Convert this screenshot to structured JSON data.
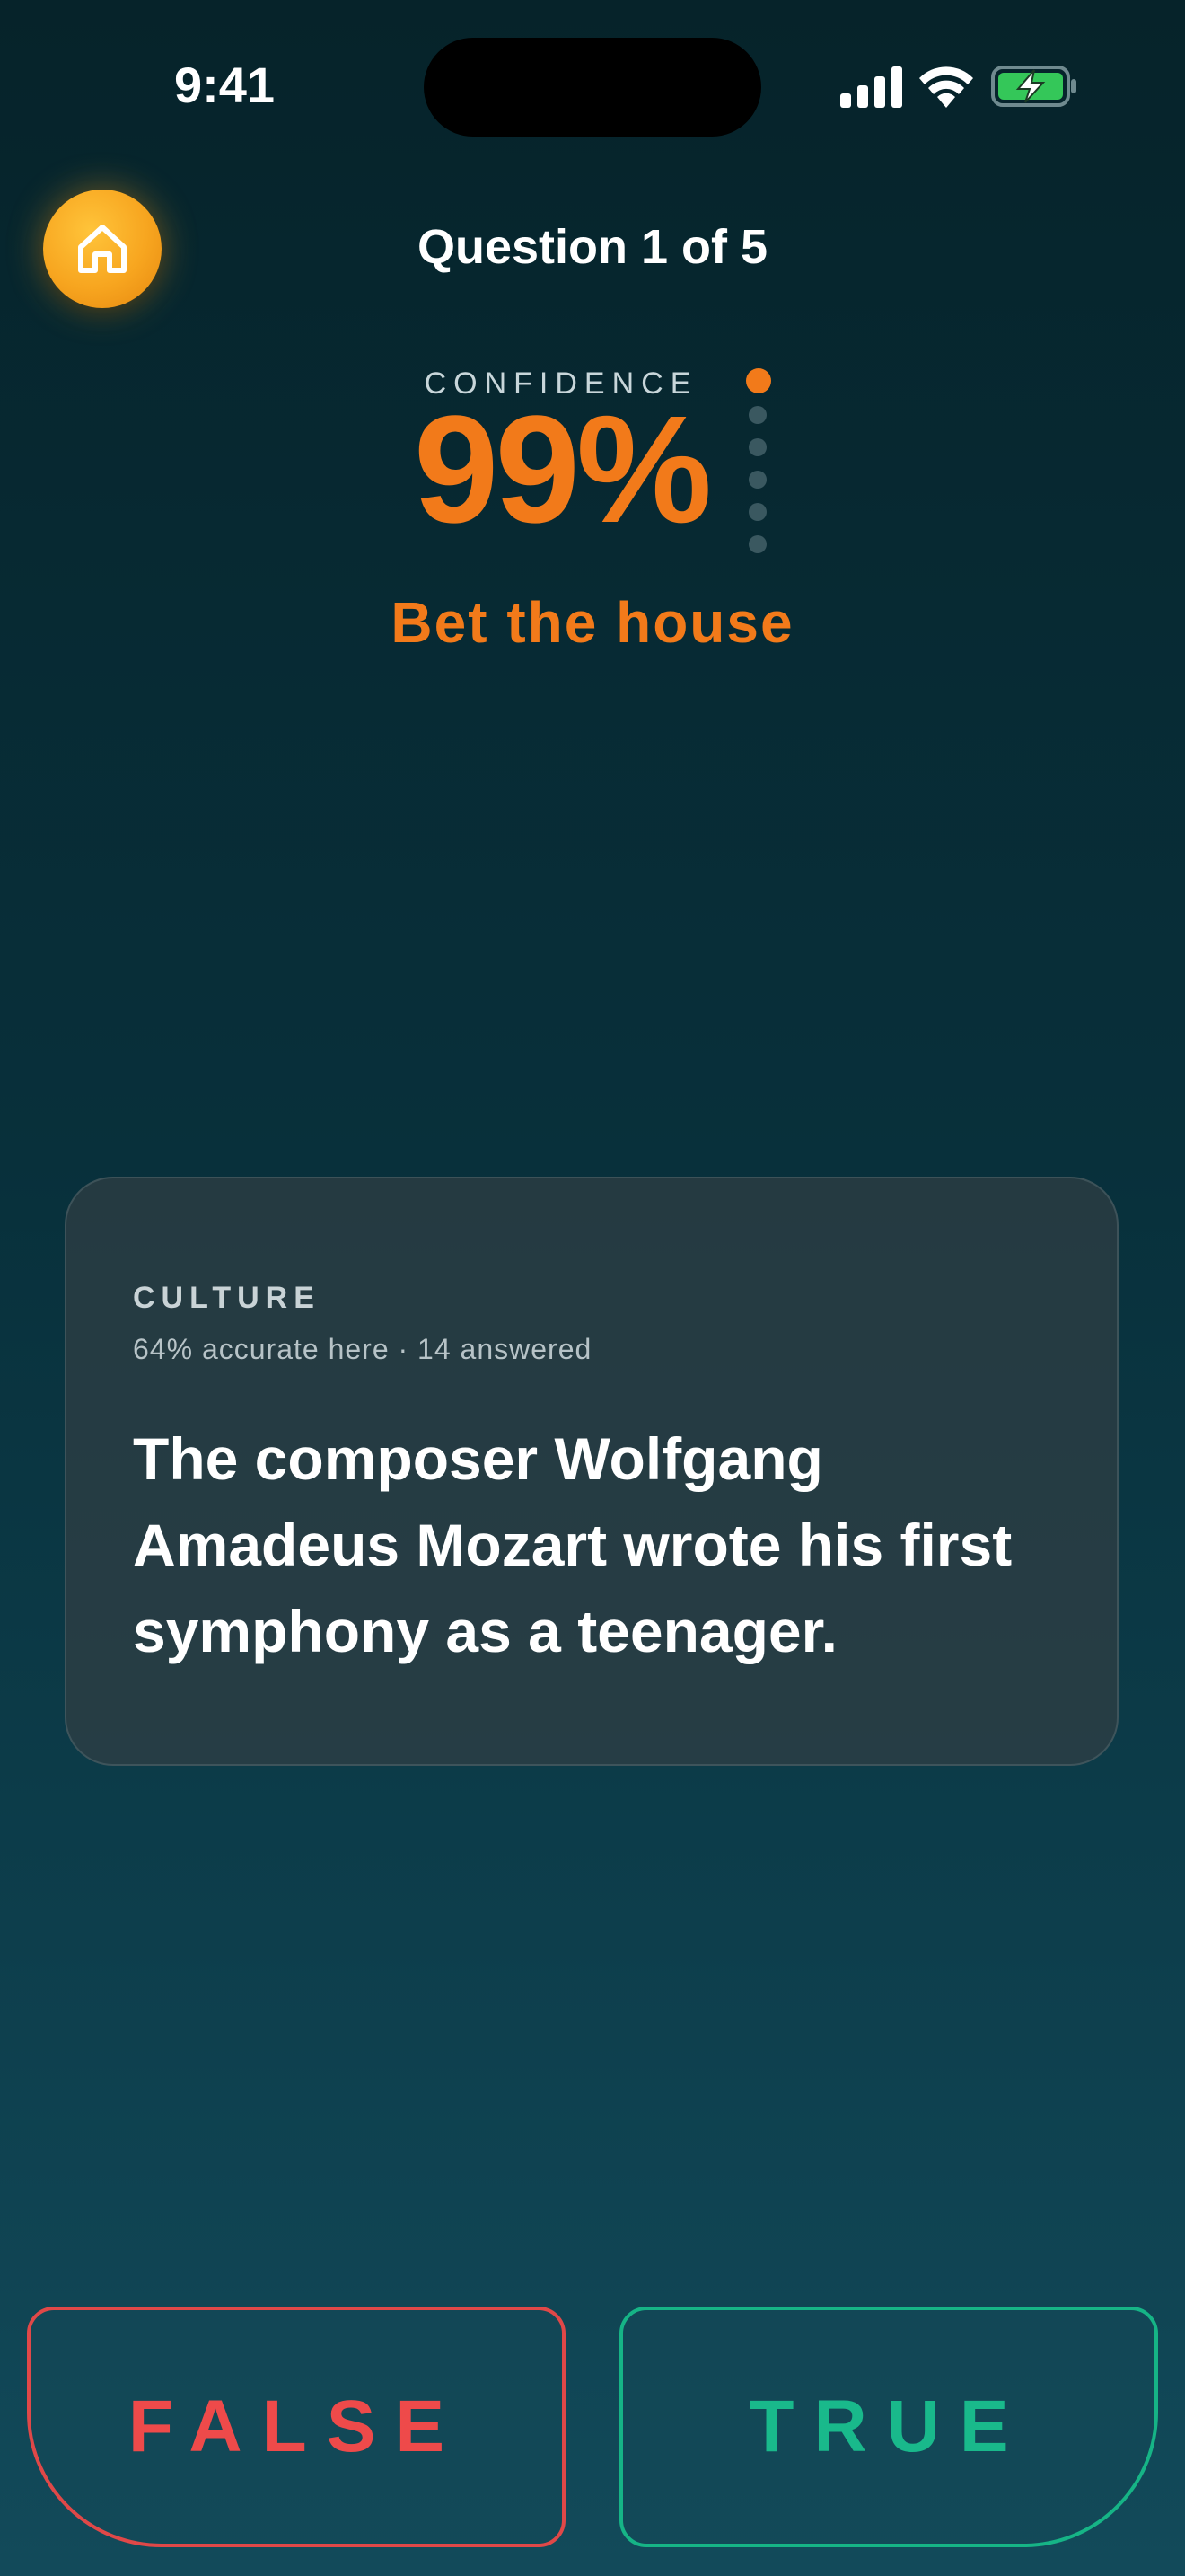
{
  "status_bar": {
    "time": "9:41",
    "icons": [
      "cellular-signal-icon",
      "wifi-icon",
      "battery-charging-icon"
    ]
  },
  "header": {
    "home_icon": "home-icon",
    "question_counter": "Question 1 of 5"
  },
  "confidence": {
    "label": "CONFIDENCE",
    "value": "99%",
    "caption": "Bet the house",
    "level_index": 0,
    "level_count": 6,
    "accent_color": "#f27a1a"
  },
  "card": {
    "category": "CULTURE",
    "stats": "64% accurate here · 14 answered",
    "question": "The composer Wolfgang Amadeus Mozart wrote his first symphony as a teenager."
  },
  "answers": {
    "false_label": "FALSE",
    "true_label": "TRUE",
    "false_color": "#e04848",
    "true_color": "#16b486"
  }
}
